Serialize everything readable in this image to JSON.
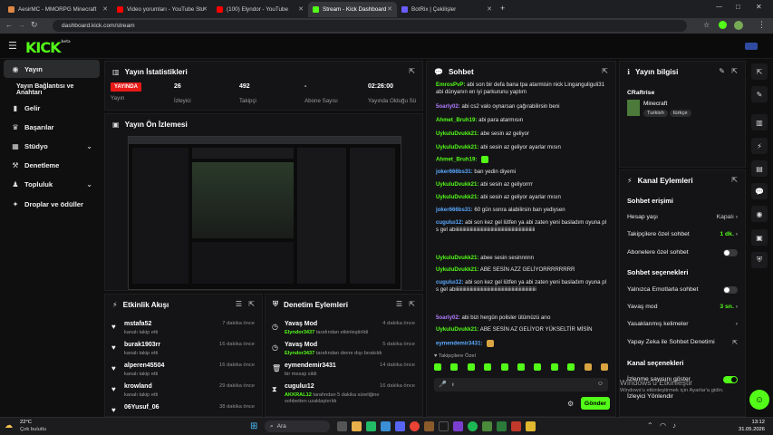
{
  "browser": {
    "tabs": [
      {
        "label": "AesirMC - MMORPG Minecraft"
      },
      {
        "label": "Video yorumları - YouTube Stu"
      },
      {
        "label": "(100) Elyndor - YouTube"
      },
      {
        "label": "Stream - Kick Dashboard"
      },
      {
        "label": "BotRix | Çekilişler"
      }
    ],
    "url": "dashboard.kick.com/stream"
  },
  "brand": {
    "logo": "KICK",
    "logo_sub": "beta",
    "accent": "#53fc18"
  },
  "sidebar": {
    "items": [
      {
        "label": "Yayın",
        "icon": "broadcast-icon"
      },
      {
        "label": "Yayın Bağlantısı ve Anahtarı",
        "icon": ""
      },
      {
        "label": "Gelir",
        "icon": "money-icon"
      },
      {
        "label": "Başarılar",
        "icon": "trophy-icon"
      },
      {
        "label": "Stüdyo",
        "icon": "studio-icon"
      },
      {
        "label": "Denetleme",
        "icon": "hammer-icon"
      },
      {
        "label": "Topluluk",
        "icon": "community-icon"
      },
      {
        "label": "Droplar ve ödüller",
        "icon": "gift-icon"
      }
    ]
  },
  "stats": {
    "title": "Yayın İstatistikleri",
    "live_badge": "YAYINDA",
    "status_label": "Yayın",
    "viewers": "26",
    "viewers_label": "İzleyici",
    "followers": "492",
    "followers_label": "Takipçi",
    "subs": "-",
    "subs_label": "Abone Sayısı",
    "duration": "02:26:00",
    "duration_label": "Yayında Olduğu Sü"
  },
  "preview": {
    "title": "Yayın Ön İzlemesi"
  },
  "activity": {
    "title": "Etkinlik Akışı",
    "items": [
      {
        "name": "mstafa52",
        "sub": "kanalı takip etti",
        "time": "7 dakika önce"
      },
      {
        "name": "burak1903rr",
        "sub": "kanalı takip etti",
        "time": "16 dakika önce"
      },
      {
        "name": "alperen45504",
        "sub": "kanalı takip etti",
        "time": "16 dakika önce"
      },
      {
        "name": "krowland",
        "sub": "kanalı takip etti",
        "time": "29 dakika önce"
      },
      {
        "name": "06Yusuf_06",
        "sub": "",
        "time": "38 dakika önce"
      }
    ]
  },
  "moderation": {
    "title": "Denetim Eylemleri",
    "items": [
      {
        "action": "Yavaş Mod",
        "actor": "Elyndor3437",
        "desc": " tarafından etkinleştirildi",
        "time": "4 dakika önce"
      },
      {
        "action": "Yavaş Mod",
        "actor": "Elyndor3437",
        "desc": " tarafından devre dışı bırakıldı",
        "time": "5 dakika önce"
      },
      {
        "action": "eymendemir3431",
        "actor": "",
        "desc": "bir mesajı sildi",
        "time": "14 dakika önce"
      },
      {
        "action": "cuguluı12",
        "actor": "AKKRAL12",
        "desc": " tarafından 5 dakika süreliğine sohbetten uzaklaştırıldı",
        "time": "16 dakika önce"
      }
    ]
  },
  "chat": {
    "title": "Sohbet",
    "messages": [
      {
        "user": "EmrosPvP:",
        "color": "#53fc18",
        "text": " abi son bir defa bana tpa atarmisin nick Linganguliguli31 abi dünyanın en iyi parkurunu yaptım"
      },
      {
        "user": "5oarly02:",
        "color": "#b07cff",
        "text": " abi cs2 valo oynarsan çağırabilirsin beni"
      },
      {
        "user": "Ahmet_Bruh19:",
        "color": "#53fc18",
        "text": " abi para atarmısın"
      },
      {
        "user": "UykuluDvukk21:",
        "color": "#53fc18",
        "text": " abe sesin az geliyor"
      },
      {
        "user": "UykuluDvukk21:",
        "color": "#53fc18",
        "text": " abi sesin az geliyor ayarlar mısın"
      },
      {
        "user": "Ahmet_Bruh19:",
        "color": "#53fc18",
        "text": " "
      },
      {
        "user": "joker666bs31:",
        "color": "#5aa9ff",
        "text": " ban yedin diyemi"
      },
      {
        "user": "UykuluDvukk21:",
        "color": "#53fc18",
        "text": " abi sesin az geliyorrrr"
      },
      {
        "user": "UykuluDvukk21:",
        "color": "#53fc18",
        "text": " abi sesin az geliyor ayarlar mısın"
      },
      {
        "user": "joker666bs31:",
        "color": "#5aa9ff",
        "text": " 60 gün sonra alabilirsin ban yediysen"
      },
      {
        "user": "cuguluı12:",
        "color": "#5aa9ff",
        "text": " abi son kez gel lütfen ya abi zaten yeni basladım oyuna pls gel abiiiiiiiiiiiiiiiiiiiiiiiiiiiiiiiiiiiiiiiiiiiiiiiiiiiiiiiiiiiiiiiii"
      },
      {
        "user": "UykuluDvukk21:",
        "color": "#53fc18",
        "text": " abee sesin sesinnnnn"
      },
      {
        "user": "UykuluDvukk21:",
        "color": "#53fc18",
        "text": " ABE SESİN AZZ GELİYORRRRRRRR"
      },
      {
        "user": "cuguluı12:",
        "color": "#5aa9ff",
        "text": " abi son kez gel lütfen ya abi zaten yeni basladım oyuna pls gel abiiiiiiiiiiiiiiiiiiiiiiiiiiiiiiiiiiiiiiiiiiiiiiiiiiiiiiiiiiiiiiiiii"
      },
      {
        "user": "5oarly02:",
        "color": "#b07cff",
        "text": " abi bizi hergün polisler ütümüzü arıo"
      },
      {
        "user": "UykuluDvukk21:",
        "color": "#53fc18",
        "text": " ABE SESİN AZ GELİYOR YÜKSELTİR MİSİN"
      },
      {
        "user": "eymendemir3431:",
        "color": "#5aa9ff",
        "text": " "
      }
    ],
    "followers_only_label": "Takipçilere Özel",
    "input_value": "ı",
    "send_label": "Gönder"
  },
  "stream_info": {
    "title": "Yayın bilgisi",
    "stream_title": "CRaftrise",
    "category": "Minecraft",
    "tags": [
      "Turkish",
      "türkçe"
    ]
  },
  "channel_actions": {
    "title": "Kanal Eylemleri",
    "chat_access_title": "Sohbet erişimi",
    "rows": [
      {
        "label": "Hesap yaşı",
        "value": "Kapalı"
      },
      {
        "label": "Takipçilere özel sohbet",
        "value": "1 dk."
      },
      {
        "label": "Abonelere özel sohbet",
        "value": ""
      }
    ],
    "chat_options_title": "Sohbet seçenekleri",
    "option_rows": [
      {
        "label": "Yalnızca Emotlarla sohbet",
        "value": ""
      },
      {
        "label": "Yavaş mod",
        "value": "3 sn."
      },
      {
        "label": "Yasaklanmış kelimeler",
        "value": ""
      },
      {
        "label": "Yapay Zeka ile Sohbet Denetimi",
        "value": ""
      }
    ],
    "channel_options_title": "Kanal seçenekleri",
    "channel_rows": [
      {
        "label": "İzlenme sayısını göster"
      },
      {
        "label": "İzleyici Yönlendir"
      }
    ]
  },
  "watermark": {
    "line1": "Windows'u Etkinleştir",
    "line2": "Windows'u etkinleştirmek için Ayarlar'a gidin."
  },
  "taskbar": {
    "weather_temp": "22°C",
    "weather_desc": "Çok bulutlu",
    "search_label": "Ara",
    "time": "13:12",
    "date": "31.05.2026"
  }
}
